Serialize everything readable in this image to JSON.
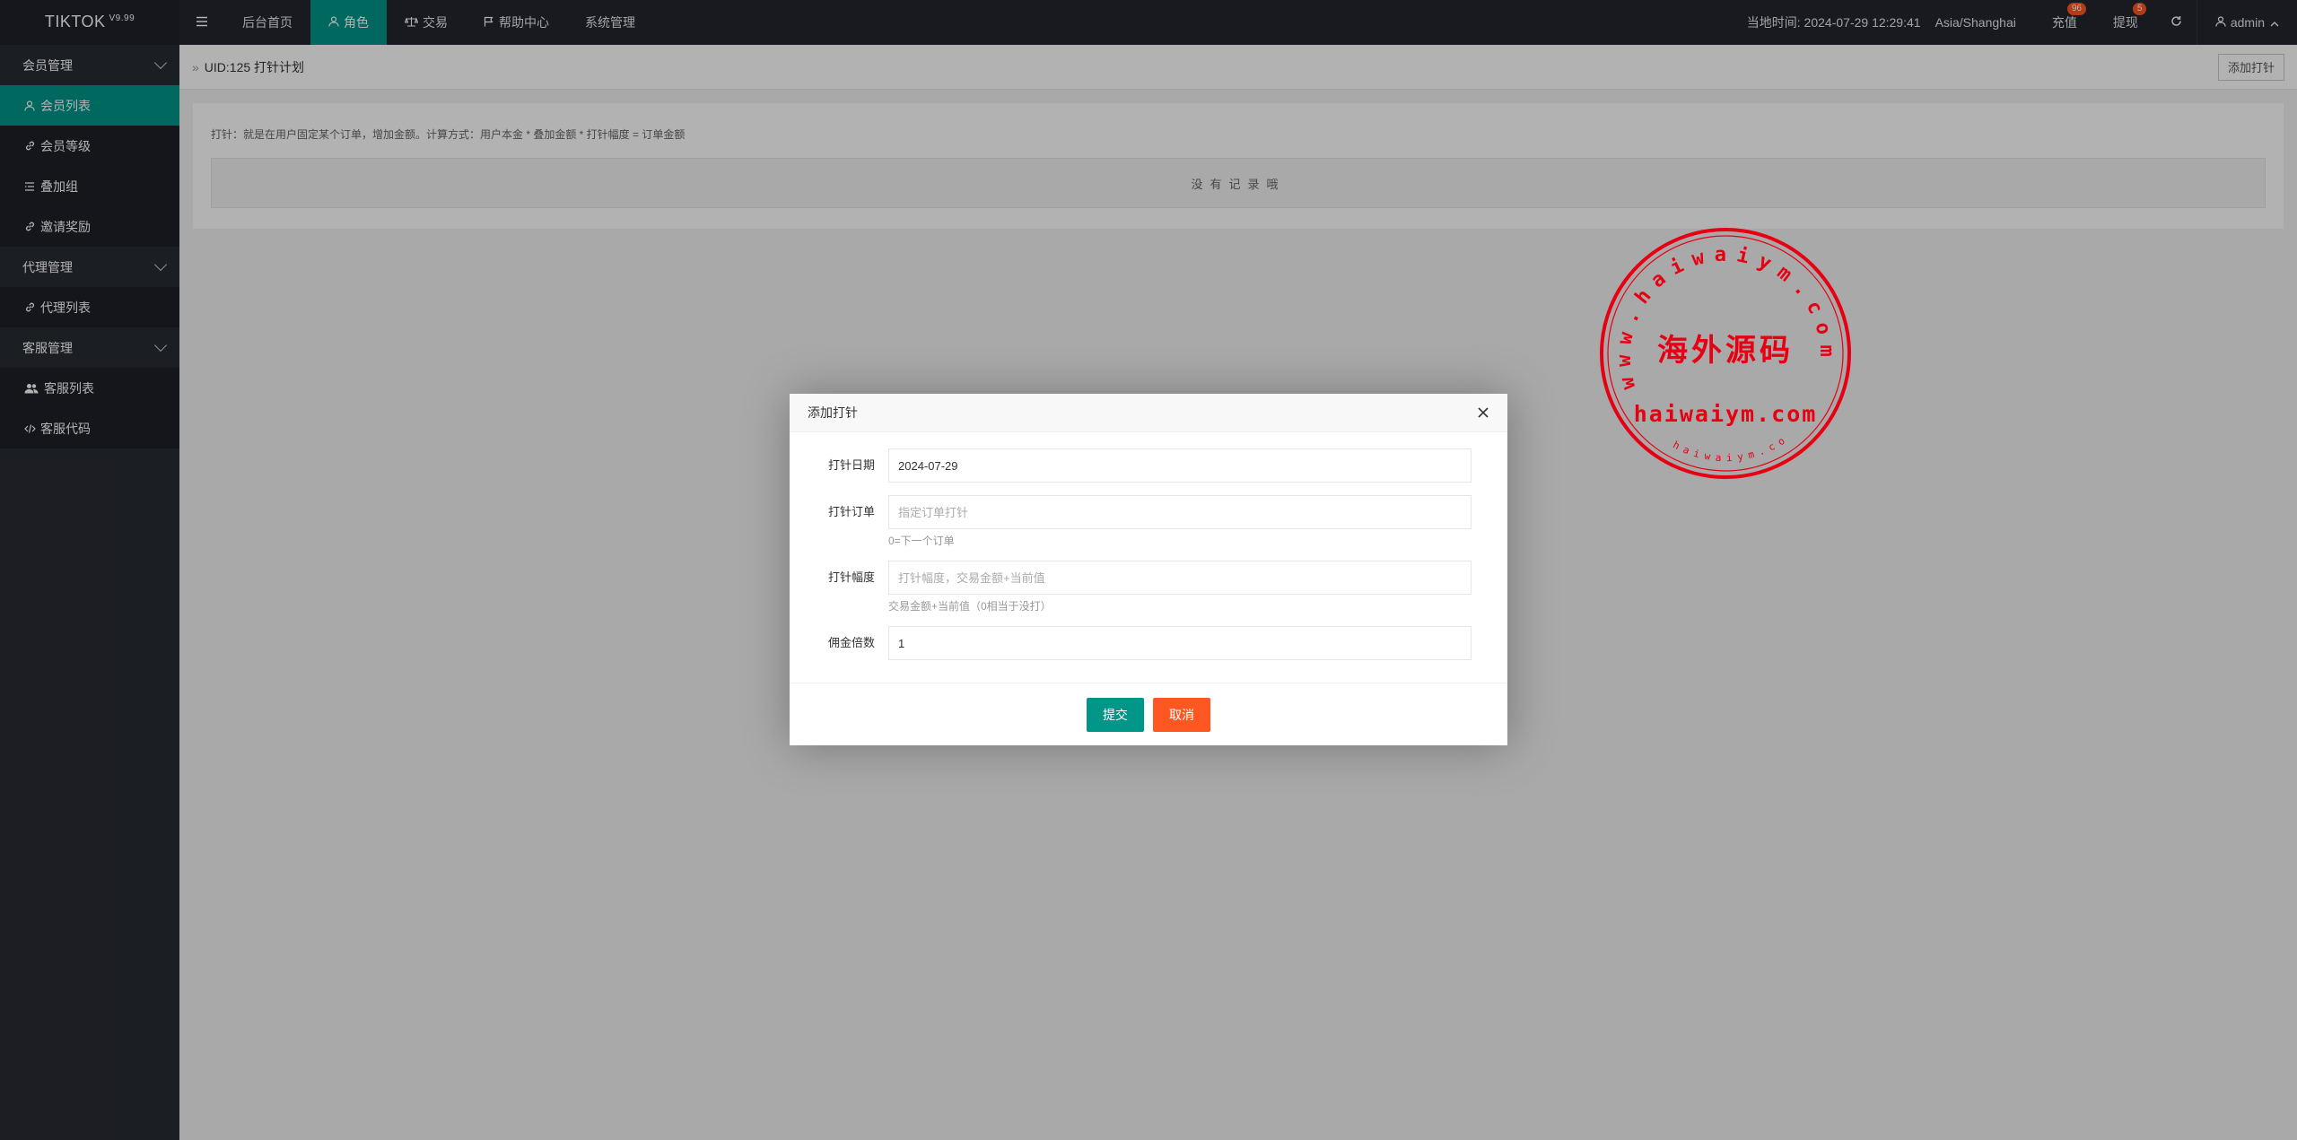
{
  "app": {
    "logo": "TIKTOK",
    "version": "V9.99"
  },
  "sidebar": {
    "groups": [
      {
        "label": "会员管理",
        "items": [
          {
            "label": "会员列表",
            "icon": "user-icon"
          },
          {
            "label": "会员等级",
            "icon": "link-icon"
          },
          {
            "label": "叠加组",
            "icon": "list-icon"
          },
          {
            "label": "邀请奖励",
            "icon": "link-icon"
          }
        ]
      },
      {
        "label": "代理管理",
        "items": [
          {
            "label": "代理列表",
            "icon": "link-icon"
          }
        ]
      },
      {
        "label": "客服管理",
        "items": [
          {
            "label": "客服列表",
            "icon": "users-icon"
          },
          {
            "label": "客服代码",
            "icon": "code-icon"
          }
        ]
      }
    ]
  },
  "header": {
    "nav": [
      {
        "label": "后台首页"
      },
      {
        "label": "角色"
      },
      {
        "label": "交易"
      },
      {
        "label": "帮助中心"
      },
      {
        "label": "系统管理"
      }
    ],
    "time_label": "当地时间: 2024-07-29 12:29:41",
    "timezone": "Asia/Shanghai",
    "recharge": {
      "label": "充值",
      "badge": "96"
    },
    "withdraw": {
      "label": "提现",
      "badge": "5"
    },
    "user": "admin"
  },
  "page": {
    "breadcrumb": "UID:125 打针计划",
    "add_button": "添加打针",
    "note": "打针：就是在用户固定某个订单，增加金额。计算方式：用户本金 * 叠加金额 * 打针幅度 = 订单金额",
    "empty_text": "没有记录哦"
  },
  "watermark": {
    "top_arc": "www.haiwaiym.com",
    "center": "海外源码",
    "domain": "haiwaiym.com",
    "bottom_arc": "haiwaiym.com"
  },
  "modal": {
    "title": "添加打针",
    "fields": {
      "date": {
        "label": "打针日期",
        "value": "2024-07-29"
      },
      "order": {
        "label": "打针订单",
        "placeholder": "指定订单打针",
        "hint": "0=下一个订单"
      },
      "amplitude": {
        "label": "打针幅度",
        "placeholder": "打针幅度，交易金额+当前值",
        "hint": "交易金额+当前值（0相当于没打）"
      },
      "commission": {
        "label": "佣金倍数",
        "value": "1"
      }
    },
    "submit": "提交",
    "cancel": "取消"
  },
  "colors": {
    "accent": "#009688",
    "warn": "#ff5722",
    "stamp": "#e60012",
    "sidebar": "#282b33",
    "header": "#23262e"
  }
}
